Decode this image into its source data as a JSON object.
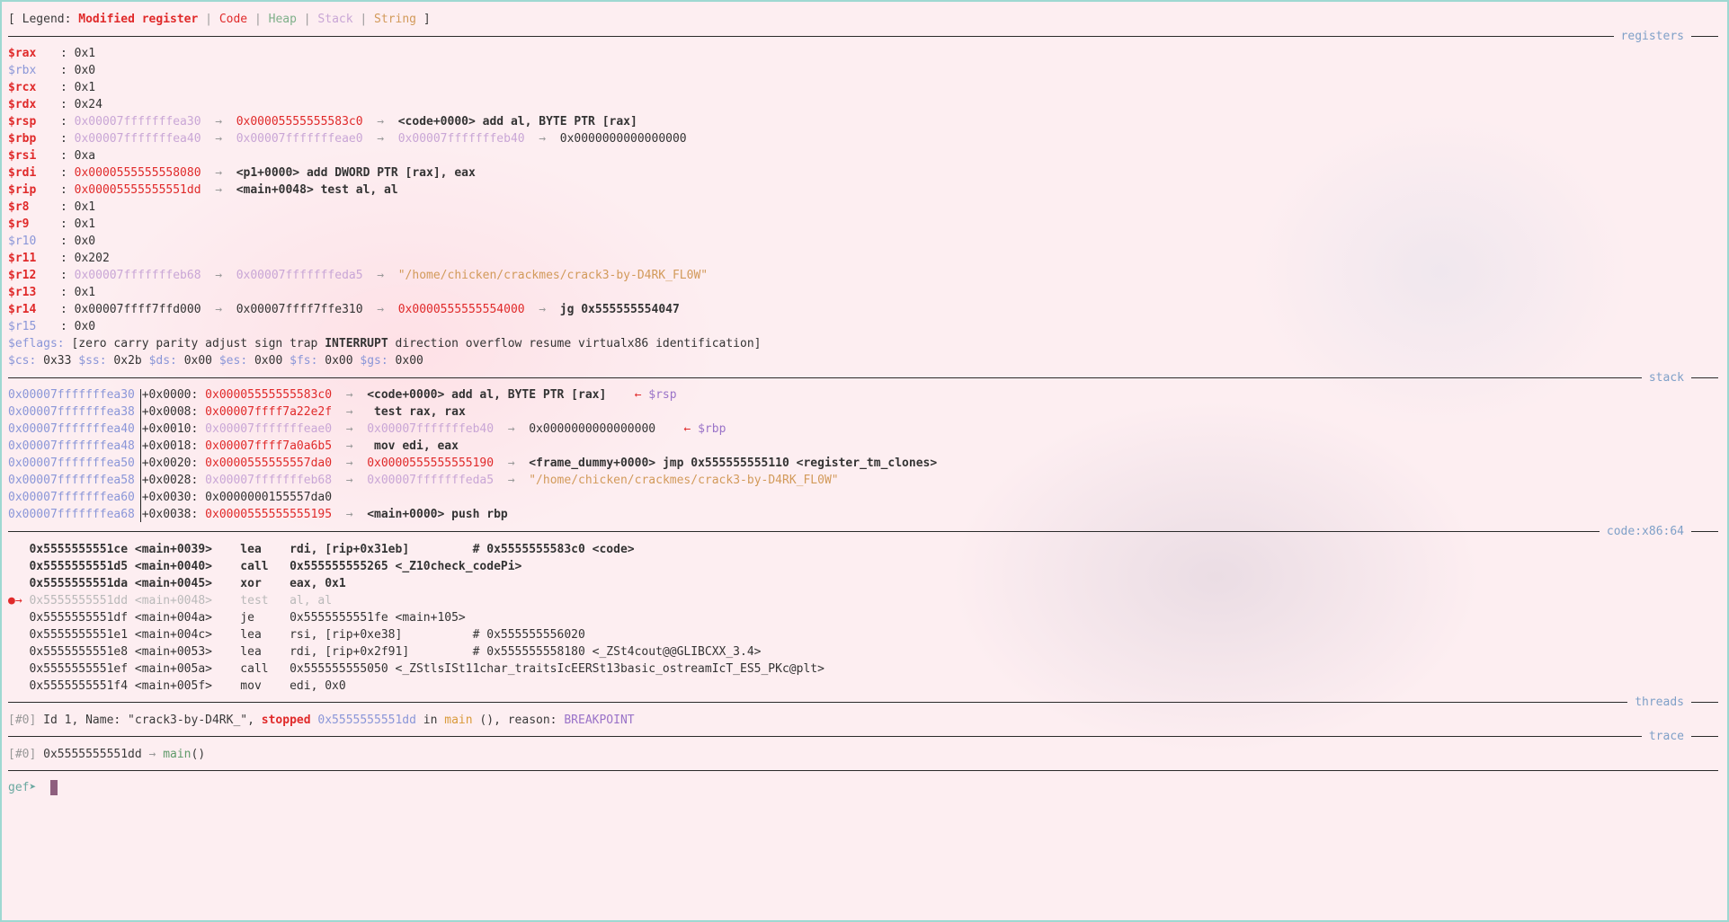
{
  "legend": {
    "prefix": "[ Legend: ",
    "modified": "Modified register",
    "code": "Code",
    "heap": "Heap",
    "stack": "Stack",
    "string": "String",
    "suffix": " ]",
    "sep": " | "
  },
  "sections": {
    "registers": "registers",
    "stack": "stack",
    "code": "code:x86:64",
    "threads": "threads",
    "trace": "trace"
  },
  "registers": [
    {
      "name": "$rax",
      "val": "0x1"
    },
    {
      "name": "$rbx",
      "val": "0x0"
    },
    {
      "name": "$rcx",
      "val": "0x1"
    },
    {
      "name": "$rdx",
      "val": "0x24"
    },
    {
      "name": "$rsp",
      "a": "0x00007fffffffea30",
      "b": "0x00005555555583c0",
      "c": "<code+0000> add al, BYTE PTR [rax]"
    },
    {
      "name": "$rbp",
      "a": "0x00007fffffffea40",
      "b": "0x00007fffffffeae0",
      "c": "0x00007fffffffeb40",
      "d": "0x0000000000000000"
    },
    {
      "name": "$rsi",
      "val": "0xa"
    },
    {
      "name": "$rdi",
      "a": "0x0000555555558080",
      "b": "<p1+0000> add DWORD PTR [rax], eax"
    },
    {
      "name": "$rip",
      "a": "0x00005555555551dd",
      "b": "<main+0048> test al, al"
    },
    {
      "name": "$r8",
      "val": "0x1"
    },
    {
      "name": "$r9",
      "val": "0x1"
    },
    {
      "name": "$r10",
      "val": "0x0"
    },
    {
      "name": "$r11",
      "val": "0x202"
    },
    {
      "name": "$r12",
      "a": "0x00007fffffffeb68",
      "b": "0x00007fffffffeda5",
      "c": "\"/home/chicken/crackmes/crack3-by-D4RK_FL0W\""
    },
    {
      "name": "$r13",
      "val": "0x1"
    },
    {
      "name": "$r14",
      "a": "0x00007ffff7ffd000",
      "b": "0x00007ffff7ffe310",
      "c": "0x0000555555554000",
      "d": "jg 0x555555554047"
    },
    {
      "name": "$r15",
      "val": "0x0"
    }
  ],
  "eflags": {
    "label": "$eflags:",
    "pre": "[zero carry parity adjust sign trap ",
    "hl": "INTERRUPT",
    "post": " direction overflow resume virtualx86 identification]"
  },
  "segs": {
    "cs": "$cs:",
    "csv": "0x33",
    "ss": "$ss:",
    "ssv": "0x2b",
    "ds": "$ds:",
    "dsv": "0x00",
    "es": "$es:",
    "esv": "0x00",
    "fs": "$fs:",
    "fsv": "0x00",
    "gs": "$gs:",
    "gsv": "0x00"
  },
  "stack": [
    {
      "addr": "0x00007fffffffea30",
      "off": "+0x0000:",
      "v1": "0x00005555555583c0",
      "rest": "<code+0000> add al, BYTE PTR [rax]",
      "tag": "$rsp"
    },
    {
      "addr": "0x00007fffffffea38",
      "off": "+0x0008:",
      "v1": "0x00007ffff7a22e2f",
      "rest": "test rax, rax"
    },
    {
      "addr": "0x00007fffffffea40",
      "off": "+0x0010:",
      "v1": "0x00007fffffffeae0",
      "v2": "0x00007fffffffeb40",
      "rest": "0x0000000000000000",
      "tag": "$rbp"
    },
    {
      "addr": "0x00007fffffffea48",
      "off": "+0x0018:",
      "v1": "0x00007ffff7a0a6b5",
      "rest": "mov edi, eax"
    },
    {
      "addr": "0x00007fffffffea50",
      "off": "+0x0020:",
      "v1": "0x0000555555557da0",
      "v2": "0x0000555555555190",
      "rest": "<frame_dummy+0000> jmp 0x555555555110 <register_tm_clones>"
    },
    {
      "addr": "0x00007fffffffea58",
      "off": "+0x0028:",
      "v1": "0x00007fffffffeb68",
      "v2": "0x00007fffffffeda5",
      "rest": "\"/home/chicken/crackmes/crack3-by-D4RK_FL0W\""
    },
    {
      "addr": "0x00007fffffffea60",
      "off": "+0x0030:",
      "rest": "0x0000000155557da0"
    },
    {
      "addr": "0x00007fffffffea68",
      "off": "+0x0038:",
      "v1": "0x0000555555555195",
      "rest": "<main+0000> push rbp"
    }
  ],
  "code": [
    {
      "addr": "0x5555555551ce <main+0039>",
      "op": "lea",
      "args": "rdi, [rip+0x31eb]",
      "cmt": "# 0x5555555583c0 <code>"
    },
    {
      "addr": "0x5555555551d5 <main+0040>",
      "op": "call",
      "args": "0x555555555265 <_Z10check_codePi>",
      "cmt": ""
    },
    {
      "addr": "0x5555555551da <main+0045>",
      "op": "xor",
      "args": "eax, 0x1",
      "cmt": ""
    },
    {
      "addr": "0x5555555551dd <main+0048>",
      "op": "test",
      "args": "al, al",
      "cmt": ""
    },
    {
      "addr": "0x5555555551df <main+004a>",
      "op": "je",
      "args": "0x5555555551fe <main+105>",
      "cmt": ""
    },
    {
      "addr": "0x5555555551e1 <main+004c>",
      "op": "lea",
      "args": "rsi, [rip+0xe38]",
      "cmt": "# 0x555555556020"
    },
    {
      "addr": "0x5555555551e8 <main+0053>",
      "op": "lea",
      "args": "rdi, [rip+0x2f91]",
      "cmt": "# 0x555555558180 <_ZSt4cout@@GLIBCXX_3.4>"
    },
    {
      "addr": "0x5555555551ef <main+005a>",
      "op": "call",
      "args": "0x555555555050 <_ZStlsISt11char_traitsIcEERSt13basic_ostreamIcT_ES5_PKc@plt>",
      "cmt": ""
    },
    {
      "addr": "0x5555555551f4 <main+005f>",
      "op": "mov",
      "args": "edi, 0x0",
      "cmt": ""
    }
  ],
  "thread": {
    "id": "[#0]",
    "pre": " Id 1, Name: \"crack3-by-D4RK_\", ",
    "stopped": "stopped",
    "addr": "0x5555555551dd",
    "in": " in ",
    "fn": "main",
    "post": " (), reason: ",
    "reason": "BREAKPOINT"
  },
  "trace": {
    "id": "[#0]",
    "addr": "0x5555555551dd",
    "arrow": "→",
    "fn": "main",
    "paren": "()"
  },
  "prompt": {
    "text": "gef➤"
  },
  "arrow": "→",
  "larrow": "←",
  "colon": ": "
}
